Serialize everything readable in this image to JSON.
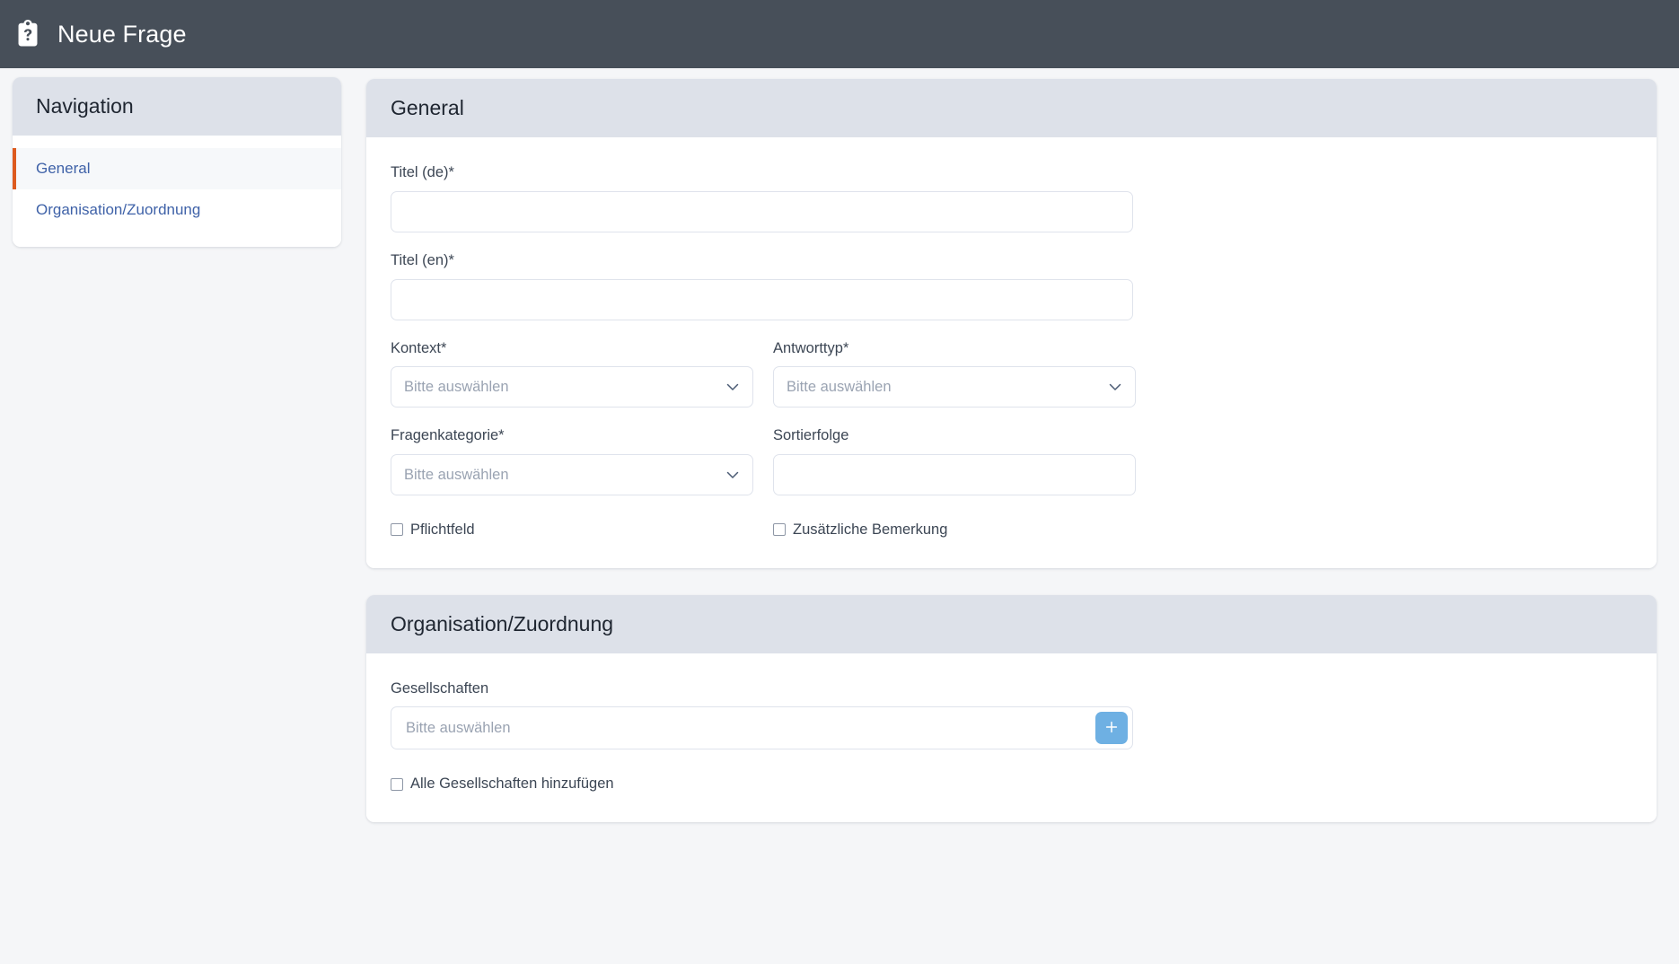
{
  "app": {
    "title": "Neue Frage",
    "icon": "clipboard-question-icon",
    "header_bg": "#474f59",
    "page_bg": "#f5f6f8",
    "card_header_bg": "#dde1e9",
    "accent_orange": "#dd5a1e",
    "link_blue": "#3f62a8",
    "add_button_blue": "#6eb0e3"
  },
  "sidebar": {
    "title": "Navigation",
    "items": [
      {
        "label": "General",
        "active": true
      },
      {
        "label": "Organisation/Zuordnung",
        "active": false
      }
    ]
  },
  "cards": {
    "general": {
      "title": "General",
      "titel_de": {
        "label": "Titel (de)*",
        "value": "",
        "placeholder": ""
      },
      "titel_en": {
        "label": "Titel (en)*",
        "value": "",
        "placeholder": ""
      },
      "kontext": {
        "label": "Kontext*",
        "value": "Bitte auswählen",
        "icon": "chevron-down-icon"
      },
      "antworttyp": {
        "label": "Antworttyp*",
        "value": "Bitte auswählen",
        "icon": "chevron-down-icon"
      },
      "fragenkategorie": {
        "label": "Fragenkategorie*",
        "value": "Bitte auswählen",
        "icon": "chevron-down-icon"
      },
      "sortierfolge": {
        "label": "Sortierfolge",
        "value": "",
        "placeholder": ""
      },
      "pflichtfeld": {
        "label": "Pflichtfeld",
        "checked": false
      },
      "zusaetzliche_bemerkung": {
        "label": "Zusätzliche Bemerkung",
        "checked": false
      }
    },
    "organisation": {
      "title": "Organisation/Zuordnung",
      "gesellschaften": {
        "label": "Gesellschaften",
        "value": "",
        "placeholder": "Bitte auswählen",
        "add_icon": "plus-icon"
      },
      "alle_gesellschaften": {
        "label": "Alle Gesellschaften hinzufügen",
        "checked": false
      }
    }
  }
}
